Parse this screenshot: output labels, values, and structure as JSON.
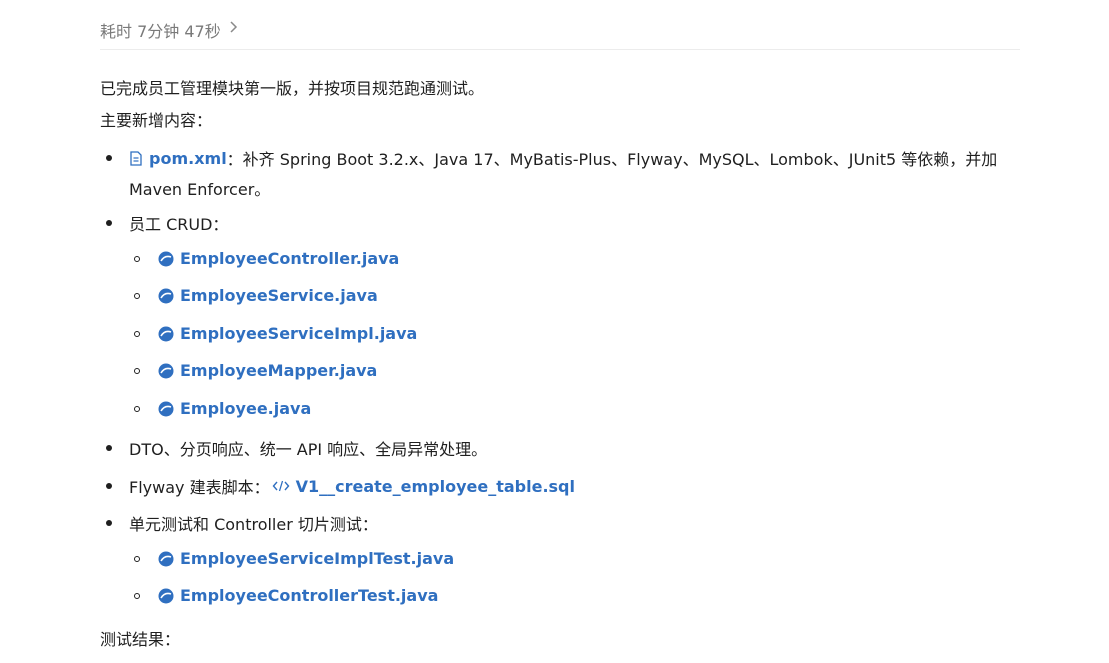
{
  "header": {
    "duration": "耗时 7分钟 47秒"
  },
  "summary": "已完成员工管理模块第一版，并按项目规范跑通测试。",
  "section_title": "主要新增内容：",
  "pom": {
    "file": "pom.xml",
    "desc_line1": "：补齐 Spring Boot 3.2.x、Java 17、MyBatis-Plus、Flyway、MySQL、Lombok、JUnit5 等依赖，并加",
    "desc_line2": "Maven Enforcer。"
  },
  "crud": {
    "label": "员工 CRUD：",
    "files": [
      "EmployeeController.java",
      "EmployeeService.java",
      "EmployeeServiceImpl.java",
      "EmployeeMapper.java",
      "Employee.java"
    ]
  },
  "dto": "DTO、分页响应、统一 API 响应、全局异常处理。",
  "flyway": {
    "label": "Flyway 建表脚本：",
    "file": "V1__create_employee_table.sql"
  },
  "tests": {
    "label": "单元测试和 Controller 切片测试：",
    "files": [
      "EmployeeServiceImplTest.java",
      "EmployeeControllerTest.java"
    ]
  },
  "results_label": "测试结果：",
  "colors": {
    "link": "#2f6fc0",
    "text": "#1f1f1f",
    "muted": "#7a7a7a"
  },
  "icons": {
    "pom": "file-doc-icon",
    "java": "java-file-icon",
    "sql": "code-file-icon",
    "chevron": "chevron-right-icon"
  }
}
